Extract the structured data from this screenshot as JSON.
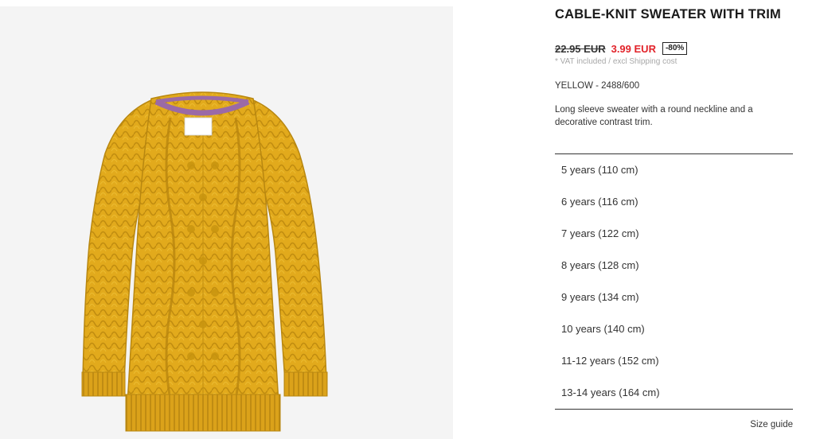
{
  "product": {
    "image_alt": "Yellow cable-knit sweater with purple contrast trim",
    "title": "CABLE-KNIT SWEATER WITH TRIM",
    "old_price": "22.95 EUR",
    "new_price": "3.99 EUR",
    "discount": "-80%",
    "vat_note": "* VAT included / excl Shipping cost",
    "color_ref": "YELLOW - 2488/600",
    "description": "Long sleeve sweater with a round neckline and a decorative contrast trim.",
    "colors": {
      "sweater": "#e0a81a",
      "trim": "#9b6aa6",
      "sale_red": "#e2232a"
    }
  },
  "sizes": [
    {
      "label": "5 years (110 cm)"
    },
    {
      "label": "6 years (116 cm)"
    },
    {
      "label": "7 years (122 cm)"
    },
    {
      "label": "8 years (128 cm)"
    },
    {
      "label": "9 years (134 cm)"
    },
    {
      "label": "10 years (140 cm)"
    },
    {
      "label": "11-12 years (152 cm)"
    },
    {
      "label": "13-14 years (164 cm)"
    }
  ],
  "size_guide_label": "Size guide"
}
